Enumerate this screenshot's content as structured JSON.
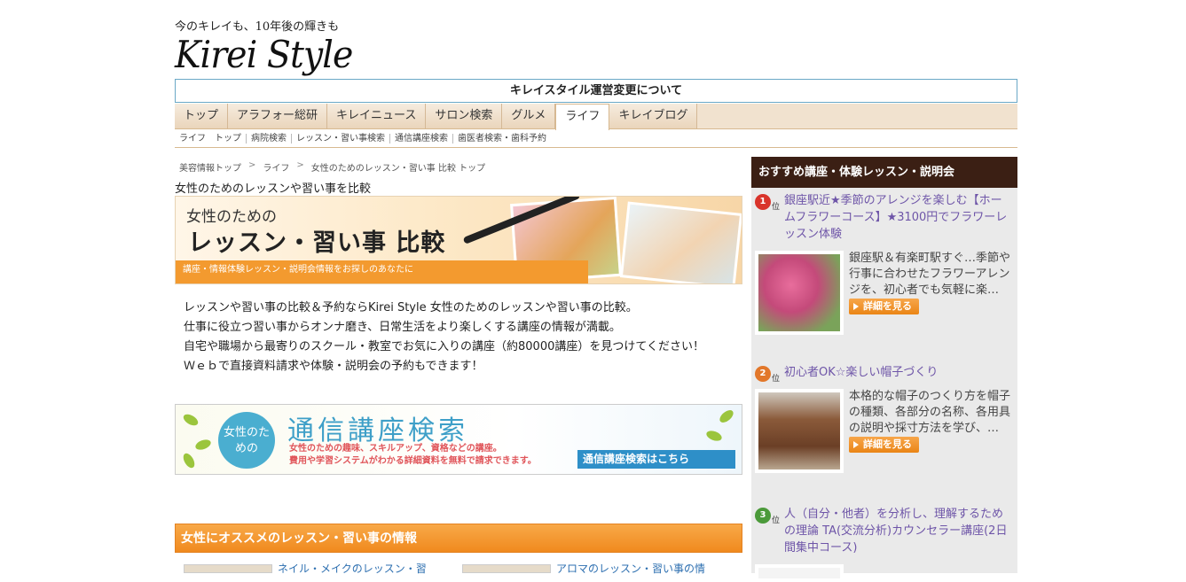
{
  "header": {
    "tagline": "今のキレイも、10年後の輝きも",
    "logo": "Kirei Style",
    "notice": "キレイスタイル運営変更について"
  },
  "global_nav": [
    {
      "label": "トップ",
      "active": false
    },
    {
      "label": "アラフォー総研",
      "active": false
    },
    {
      "label": "キレイニュース",
      "active": false
    },
    {
      "label": "サロン検索",
      "active": false
    },
    {
      "label": "グルメ",
      "active": false
    },
    {
      "label": "ライフ",
      "active": true
    },
    {
      "label": "キレイブログ",
      "active": false
    }
  ],
  "sub_nav": [
    "ライフ　トップ",
    "病院検索",
    "レッスン・習い事検索",
    "通信講座検索",
    "歯医者検索・歯科予約"
  ],
  "breadcrumb": [
    "美容情報トップ",
    "ライフ",
    "女性のためのレッスン・習い事 比較 トップ"
  ],
  "page_title": "女性のためのレッスンや習い事を比較",
  "hero": {
    "small": "女性のための",
    "big": "レッスン・習い事 比較",
    "strip": "講座・情報体験レッスン・説明会情報をお探しのあなたに"
  },
  "intro": [
    "レッスンや習い事の比較＆予約ならKirei Style 女性のためのレッスンや習い事の比較。",
    "仕事に役立つ習い事からオンナ磨き、日常生活をより楽しくする講座の情報が満載。",
    "自宅や職場から最寄りのスクール・教室でお気に入りの講座（約80000講座）を見つけてください！",
    "Ｗｅｂで直接資料請求や体験・説明会の予約もできます！"
  ],
  "ad": {
    "circle": "女性のための",
    "title": "通信講座検索",
    "desc1": "女性のための趣味、スキルアップ、資格などの講座。",
    "desc2": "費用や学習システムがわかる詳細資料を無料で請求できます。",
    "button": "通信講座検索はこちら"
  },
  "section": {
    "title": "女性にオススメのレッスン・習い事の情報",
    "peek_left": "ネイル・メイクのレッスン・習",
    "peek_right": "アロマのレッスン・習い事の情"
  },
  "sidebar": {
    "title": "おすすめ講座・体験レッスン・説明会",
    "rank_suffix": "位",
    "detail_label": "詳細を見る",
    "items": [
      {
        "rank": "1",
        "color": "#d9342b",
        "title": "銀座駅近★季節のアレンジを楽しむ【ホームフラワーコース】★3100円でフラワーレッスン体験",
        "desc": "銀座駅＆有楽町駅すぐ…季節や行事に合わせたフラワーアレンジを、初心者でも気軽に楽…"
      },
      {
        "rank": "2",
        "color": "#e2772a",
        "title": "初心者OK☆楽しい帽子づくり",
        "desc": "本格的な帽子のつくり方を帽子の種類、各部分の名称、各用具の説明や採寸方法を学び、…"
      },
      {
        "rank": "3",
        "color": "#4b9a3a",
        "title": "人（自分・他者）を分析し、理解するための理論 TA(交流分析)カウンセラー講座(2日間集中コース)",
        "desc": ""
      }
    ]
  },
  "colors": {
    "accent_orange": "#f08a1e",
    "sidebar_header": "#3b1f14",
    "nav_bg": "#f1e2cf",
    "link_purple": "#6e55a8"
  }
}
